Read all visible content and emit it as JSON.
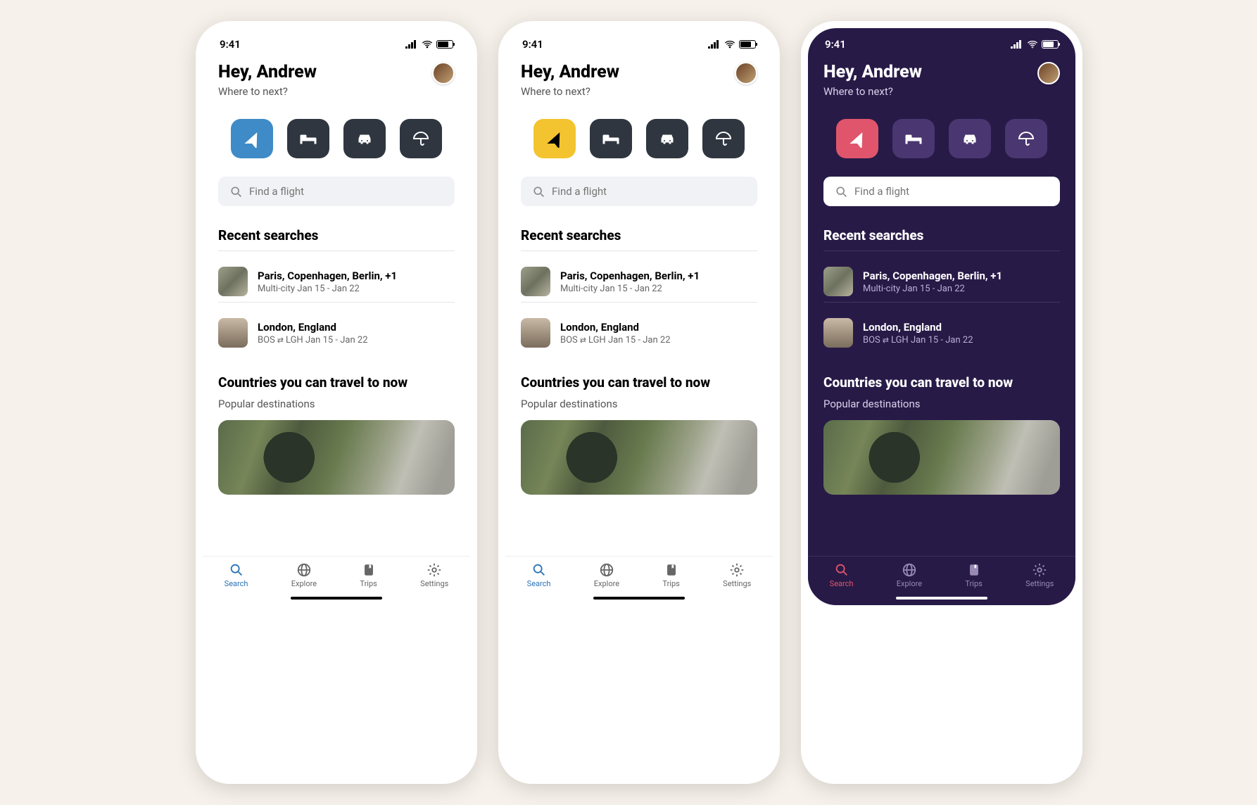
{
  "status": {
    "time": "9:41"
  },
  "header": {
    "greeting": "Hey, Andrew",
    "subgreeting": "Where to next?"
  },
  "categories": [
    {
      "icon": "plane",
      "active": true
    },
    {
      "icon": "bed",
      "active": false
    },
    {
      "icon": "car",
      "active": false
    },
    {
      "icon": "umbrella",
      "active": false
    }
  ],
  "search": {
    "placeholder": "Find a flight"
  },
  "recent": {
    "title": "Recent searches",
    "items": [
      {
        "title": "Paris, Copenhagen, Berlin, +1",
        "type": "Multi-city",
        "dates": "Jan 15 - Jan 22",
        "swap": false
      },
      {
        "title": "London, England",
        "from": "BOS",
        "to": "LGH",
        "dates": "Jan 15 - Jan 22",
        "swap": true
      }
    ]
  },
  "travel": {
    "title": "Countries you can travel to now",
    "subtitle": "Popular destinations"
  },
  "tabs": [
    {
      "label": "Search",
      "icon": "search-icon",
      "active": true
    },
    {
      "label": "Explore",
      "icon": "globe-icon",
      "active": false
    },
    {
      "label": "Trips",
      "icon": "bookmark-icon",
      "active": false
    },
    {
      "label": "Settings",
      "icon": "gear-icon",
      "active": false
    }
  ],
  "themes": [
    {
      "name": "light",
      "accent": "#3e8bc7",
      "bg": "#ffffff"
    },
    {
      "name": "yellow",
      "accent": "#f3c430",
      "bg": "#ffffff"
    },
    {
      "name": "dark",
      "accent": "#e0556b",
      "bg": "#281a47"
    }
  ]
}
